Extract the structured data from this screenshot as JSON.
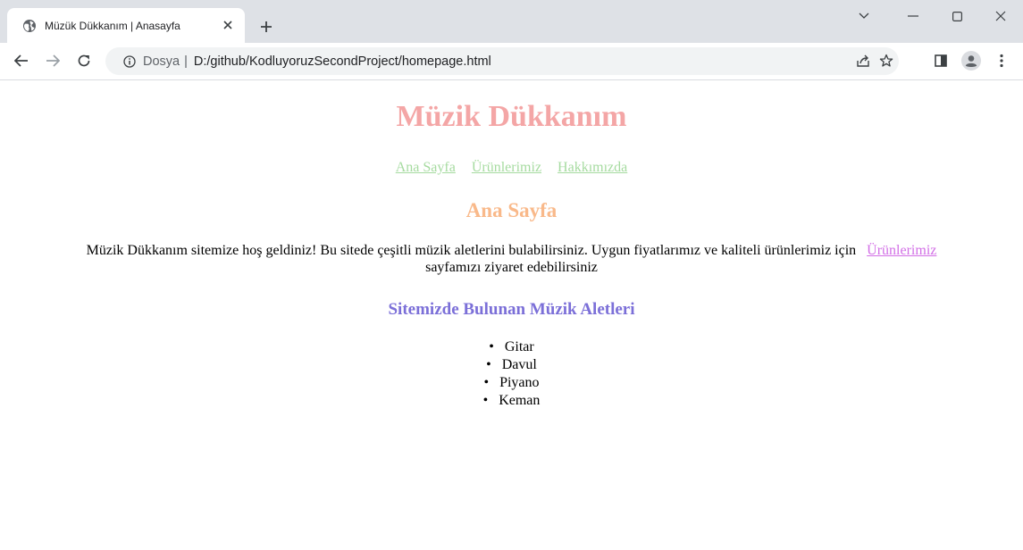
{
  "browser": {
    "tab_title": "Müzük Dükkanım | Anasayfa",
    "url_scheme": "Dosya",
    "url_separator": "|",
    "url": "D:/github/KodluyoruzSecondProject/homepage.html"
  },
  "page": {
    "title": "Müzik Dükkanım",
    "nav": [
      "Ana Sayfa",
      "Ürünlerimiz",
      "Hakkımızda"
    ],
    "section_heading": "Ana Sayfa",
    "intro_text": "Müzik Dükkanım sitemize hoş geldiniz! Bu sitede çeşitli müzik aletlerini bulabilirsiniz. Uygun fiyatlarımız ve kaliteli ürünlerimiz için",
    "intro_link": "Ürünlerimiz",
    "intro_text_end": "sayfamızı ziyaret edebilirsiniz",
    "list_heading": "Sitemizde Bulunan Müzik Aletleri",
    "instruments": [
      "Gitar",
      "Davul",
      "Piyano",
      "Keman"
    ]
  },
  "colors": {
    "title": "#f4a6a6",
    "nav_link": "#a6dba0",
    "section_heading": "#f9b98a",
    "intro_link": "#d26ee6",
    "list_heading": "#7b6fd8"
  }
}
